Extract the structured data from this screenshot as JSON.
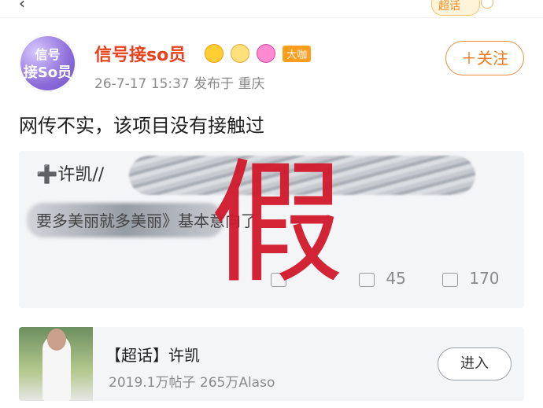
{
  "topbar": {
    "back_label": "‹",
    "super_badge_label": "超话"
  },
  "header": {
    "avatar_line1": "信号",
    "avatar_line2": "接So员",
    "username": "信号接so员",
    "badge_label": "大咖",
    "meta": "26-7-17 15:37  发布于 重庆",
    "follow_label": "＋关注"
  },
  "post": {
    "text": "网传不实，该项目没有接触过"
  },
  "repost": {
    "top_text": "➕许凯//",
    "body_text": "要多美丽就多美丽》基本意向了",
    "overlay_stamp": "假",
    "actions": {
      "share_count": "",
      "comment_count": "45",
      "like_count": "170"
    }
  },
  "supertopic": {
    "title": "【超话】许凯",
    "subtitle": "2019.1万帖子 265万Alaso",
    "enter_label": "进入"
  }
}
